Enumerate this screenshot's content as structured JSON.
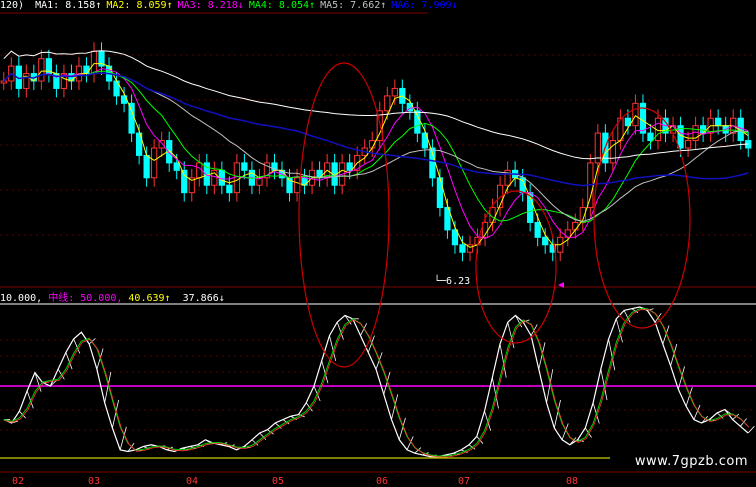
{
  "top_header": {
    "prefix": "120)",
    "items": [
      {
        "label": "MA1",
        "value": "8.158",
        "arrow": "↑",
        "color": "#ffffff"
      },
      {
        "label": "MA2",
        "value": "8.059",
        "arrow": "↑",
        "color": "#ffff00"
      },
      {
        "label": "MA3",
        "value": "8.218",
        "arrow": "↓",
        "color": "#ff00ff"
      },
      {
        "label": "MA4",
        "value": "8.054",
        "arrow": "↑",
        "color": "#00ff00"
      },
      {
        "label": "MA5",
        "value": "7.662",
        "arrow": "↑",
        "color": "#c0c0c0"
      },
      {
        "label": "MA6",
        "value": "7.909",
        "arrow": "↓",
        "color": "#0000ff"
      }
    ]
  },
  "low_marker": "6.23",
  "bottom_header": {
    "prefix": "10.000,",
    "mid_label": "中线",
    "mid_value": "50.000",
    "v1": "40.639",
    "v1_arrow": "↑",
    "v2": "37.866",
    "v2_arrow": "↓"
  },
  "months": [
    "02",
    "03",
    "04",
    "05",
    "06",
    "07",
    "08"
  ],
  "watermark": "www.7gpzb.com",
  "colors": {
    "up": "#ff3333",
    "down": "#00ffff",
    "ma1": "#ffffff",
    "ma2": "#ffff00",
    "ma3": "#ff00ff",
    "ma4": "#00ff00",
    "ma5": "#c0c0c0",
    "ma6": "#1010c0",
    "k_line": "#ffffff",
    "d_line": "#ffff00",
    "mid_line": "#ff00ff",
    "circle": "#cc0000"
  },
  "chart_data": {
    "type": "candlestick",
    "y_range": [
      6.0,
      9.6
    ],
    "oscillator_range": [
      0,
      100
    ],
    "oscillator_mid": 50,
    "oscillator_lines": [
      100,
      10
    ],
    "circle_count": 3,
    "closes": [
      8.7,
      8.9,
      8.6,
      8.8,
      8.7,
      9.0,
      8.8,
      8.6,
      8.8,
      8.7,
      8.9,
      8.8,
      9.1,
      8.9,
      8.7,
      8.5,
      8.4,
      8.0,
      7.7,
      7.4,
      7.8,
      7.9,
      7.6,
      7.5,
      7.2,
      7.4,
      7.6,
      7.3,
      7.5,
      7.3,
      7.2,
      7.6,
      7.5,
      7.3,
      7.4,
      7.6,
      7.5,
      7.4,
      7.2,
      7.4,
      7.3,
      7.5,
      7.4,
      7.6,
      7.3,
      7.6,
      7.5,
      7.7,
      7.8,
      7.9,
      8.3,
      8.5,
      8.6,
      8.4,
      8.3,
      8.0,
      7.8,
      7.4,
      7.0,
      6.7,
      6.5,
      6.4,
      6.5,
      6.6,
      6.8,
      7.0,
      7.3,
      7.5,
      7.4,
      7.2,
      6.8,
      6.6,
      6.5,
      6.4,
      6.6,
      6.7,
      6.8,
      7.0,
      7.6,
      8.0,
      7.6,
      7.9,
      8.2,
      8.1,
      8.4,
      8.0,
      7.9,
      8.2,
      8.0,
      8.1,
      7.8,
      7.9,
      8.1,
      8.0,
      8.2,
      8.1,
      8.0,
      8.2,
      7.9,
      7.8
    ],
    "indicator": [
      30,
      28,
      35,
      47,
      58,
      52,
      50,
      60,
      70,
      78,
      82,
      75,
      60,
      40,
      25,
      12,
      11,
      12,
      14,
      15,
      14,
      12,
      11,
      13,
      14,
      15,
      18,
      16,
      15,
      14,
      12,
      14,
      18,
      22,
      24,
      28,
      30,
      32,
      33,
      40,
      50,
      65,
      80,
      88,
      92,
      90,
      80,
      70,
      60,
      45,
      30,
      18,
      12,
      10,
      9,
      8,
      8,
      9,
      10,
      12,
      15,
      20,
      35,
      55,
      75,
      88,
      92,
      88,
      80,
      60,
      40,
      25,
      18,
      15,
      18,
      25,
      40,
      60,
      78,
      90,
      95,
      96,
      97,
      95,
      88,
      75,
      62,
      48,
      38,
      30,
      28,
      30,
      34,
      36,
      30,
      26,
      22
    ]
  }
}
